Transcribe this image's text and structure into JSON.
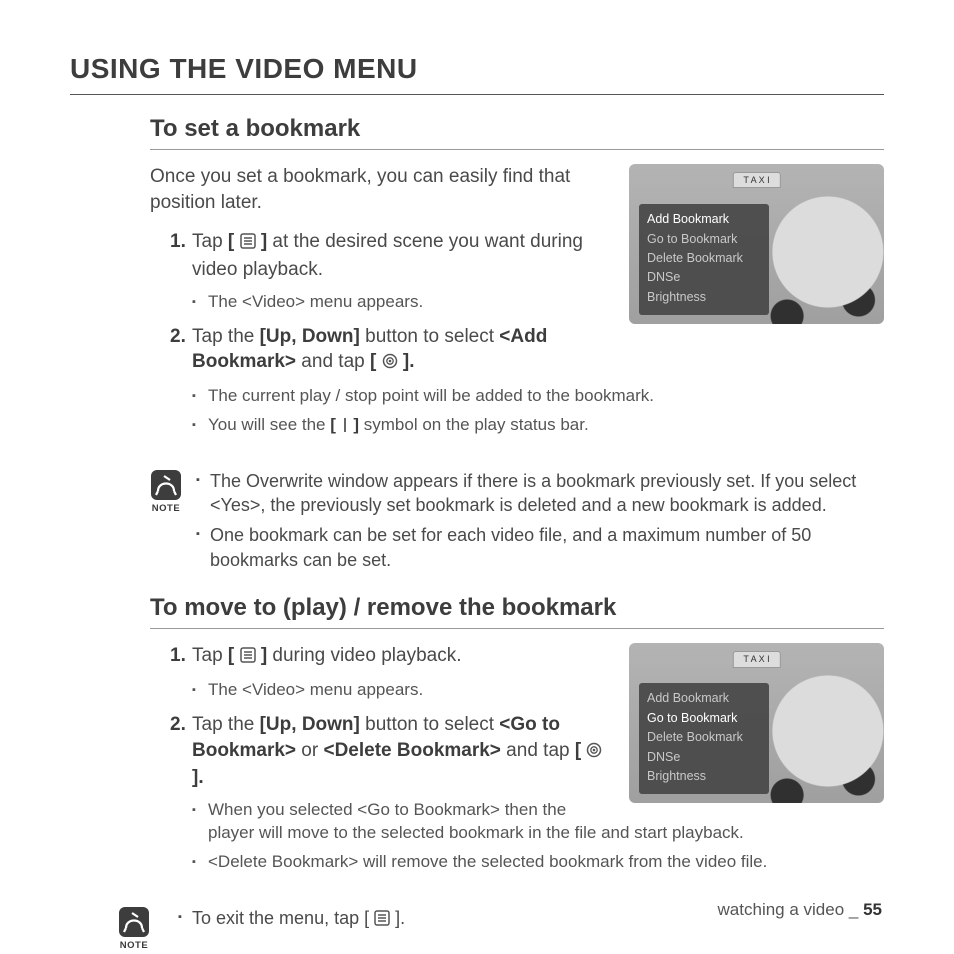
{
  "page_title": "USING THE VIDEO MENU",
  "section1": {
    "heading": "To set a bookmark",
    "intro": "Once you set a bookmark, you can easily find that position later.",
    "step1_a": "Tap ",
    "step1_b": " at the desired scene you want during video playback.",
    "step1_sub1": "The <Video> menu appears.",
    "step2_a": "Tap the ",
    "step2_b": "[Up, Down]",
    "step2_c": " button to select ",
    "step2_d": "<Add Bookmark>",
    "step2_e": " and tap ",
    "step2_sub1": "The current play / stop point will be added to the bookmark.",
    "step2_sub2_a": "You will see the ",
    "step2_sub2_b": " symbol on the play status bar."
  },
  "note1": {
    "label": "NOTE",
    "item1": "The Overwrite window appears if there is a bookmark previously set. If you select <Yes>, the previously set bookmark is deleted and a new bookmark is added.",
    "item2": "One bookmark can be set for each video file, and a maximum number of 50 bookmarks can be set."
  },
  "section2": {
    "heading": "To move to (play) / remove the bookmark",
    "step1_a": "Tap ",
    "step1_b": " during video playback.",
    "step1_sub1": "The <Video> menu appears.",
    "step2_a": "Tap the ",
    "step2_b": "[Up, Down]",
    "step2_c": " button to select ",
    "step2_d": "<Go to Bookmark>",
    "step2_e": " or ",
    "step2_f": "<Delete Bookmark>",
    "step2_g": " and tap ",
    "step2_sub1": "When you selected <Go to Bookmark> then the player will move to the selected bookmark in the file and start playback.",
    "step2_sub2": "<Delete Bookmark> will remove the selected bookmark from the video file."
  },
  "note2": {
    "label": "NOTE",
    "item1_a": "To exit the menu, tap [ ",
    "item1_b": " ]."
  },
  "menu": {
    "taxi": "T A X I",
    "add": "Add Bookmark",
    "goto": "Go to Bookmark",
    "delete": "Delete Bookmark",
    "dnse": "DNSe",
    "brightness": "Brightness"
  },
  "icons": {
    "menu_bracket_open": "[",
    "menu_bracket_close": "]",
    "select_bracket_open": "[",
    "select_bracket_close": "].",
    "bar_bracket_open": "[",
    "bar_bracket_close": "]"
  },
  "footer": {
    "text": "watching a video _ ",
    "page": "55"
  }
}
